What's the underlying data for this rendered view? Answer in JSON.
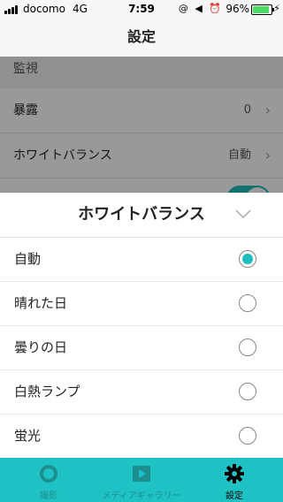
{
  "status_bar": {
    "carrier": "docomo",
    "network": "4G",
    "time": "7:59",
    "icons": "@ ◀ ⏰",
    "battery": "96%",
    "battery_color": "#4cd964"
  },
  "nav": {
    "title": "設定"
  },
  "settings": {
    "section": "監視",
    "rows": [
      {
        "label": "暴露",
        "value": "0"
      },
      {
        "label": "ホワイトバランス",
        "value": "自動"
      }
    ]
  },
  "sheet": {
    "title": "ホワイトバランス",
    "close_icon": "chevron-down-icon",
    "options": [
      {
        "label": "自動",
        "selected": true
      },
      {
        "label": "晴れた日",
        "selected": false
      },
      {
        "label": "曇りの日",
        "selected": false
      },
      {
        "label": "白熱ランプ",
        "selected": false
      },
      {
        "label": "蛍光",
        "selected": false
      }
    ]
  },
  "tabs": [
    {
      "label": "撮影",
      "icon": "camera-lens-icon"
    },
    {
      "label": "メディアギャラリー",
      "icon": "play-icon"
    },
    {
      "label": "設定",
      "icon": "gear-icon",
      "active": true
    }
  ],
  "colors": {
    "accent": "#1fc2c4"
  }
}
